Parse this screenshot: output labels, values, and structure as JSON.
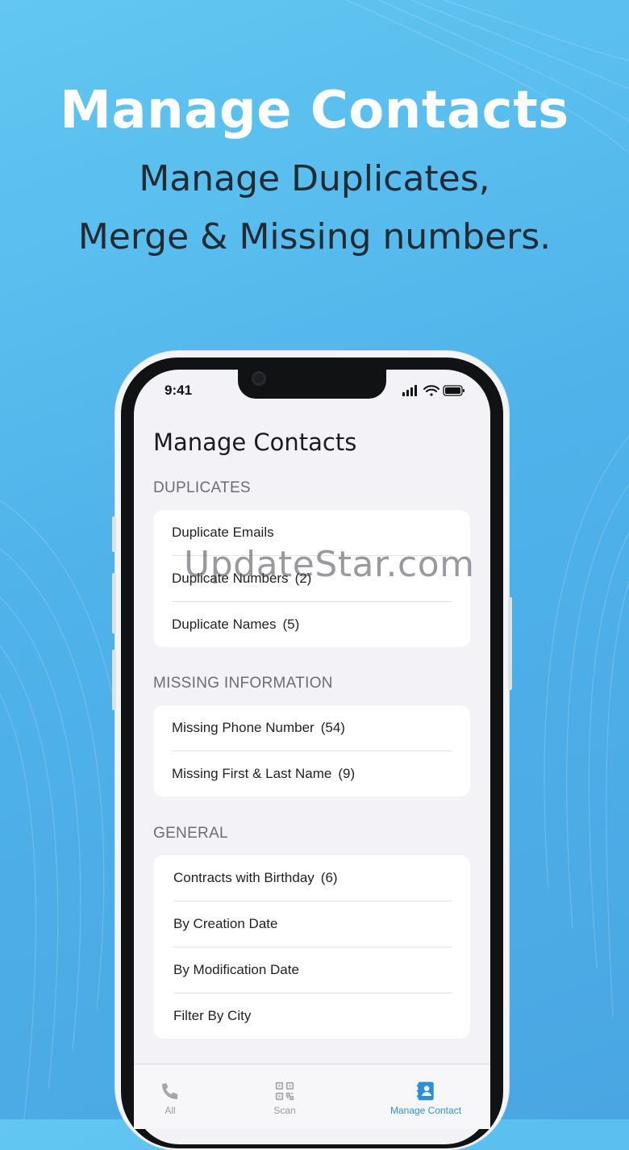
{
  "hero": {
    "title": "Manage Contacts",
    "subtitle_line1": "Manage Duplicates,",
    "subtitle_line2": "Merge & Missing numbers."
  },
  "status_bar": {
    "time": "9:41",
    "icons": [
      "cellular-signal-icon",
      "wifi-icon",
      "battery-icon"
    ]
  },
  "app": {
    "title": "Manage Contacts",
    "sections": [
      {
        "label": "DUPLICATES",
        "items": [
          {
            "label": "Duplicate Emails",
            "count": ""
          },
          {
            "label": "Duplicate Numbers",
            "count": "(2)"
          },
          {
            "label": "Duplicate Names",
            "count": "(5)"
          }
        ]
      },
      {
        "label": "MISSING INFORMATION",
        "items": [
          {
            "label": "Missing Phone Number",
            "count": "(54)"
          },
          {
            "label": "Missing First & Last Name",
            "count": "(9)"
          }
        ]
      },
      {
        "label": "GENERAL",
        "items": [
          {
            "label": "Contracts with Birthday",
            "count": "(6)"
          },
          {
            "label": "By Creation Date",
            "count": ""
          },
          {
            "label": "By Modification Date",
            "count": ""
          },
          {
            "label": "Filter By City",
            "count": ""
          }
        ]
      }
    ]
  },
  "tabbar": {
    "tabs": [
      {
        "label": "All",
        "icon": "phone-icon",
        "active": false
      },
      {
        "label": "Scan",
        "icon": "qr-code-icon",
        "active": false
      },
      {
        "label": "Manage Contact",
        "icon": "contact-book-icon",
        "active": true
      }
    ]
  },
  "watermark": "UpdateStar.com",
  "colors": {
    "background": "#55b8ec",
    "accent": "#2f8fd6",
    "inactive_tab": "#9a9aa0"
  }
}
